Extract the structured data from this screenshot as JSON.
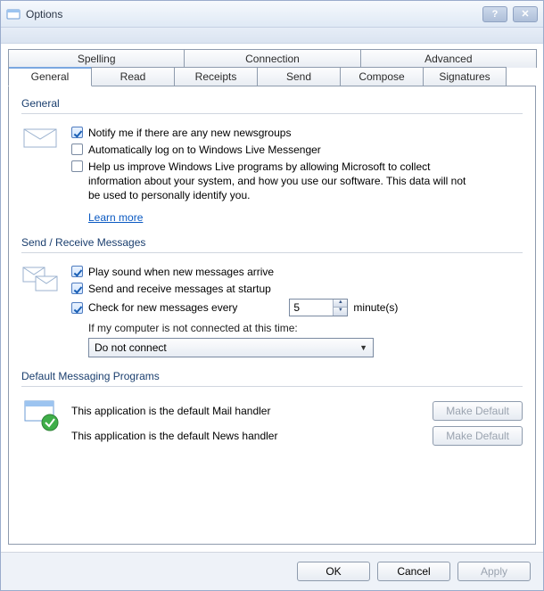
{
  "window": {
    "title": "Options"
  },
  "tabs_row1": {
    "spelling": "Spelling",
    "connection": "Connection",
    "advanced": "Advanced"
  },
  "tabs_row2": {
    "general": "General",
    "read": "Read",
    "receipts": "Receipts",
    "send": "Send",
    "compose": "Compose",
    "signatures": "Signatures"
  },
  "general": {
    "title": "General",
    "notify": "Notify me if there are any new newsgroups",
    "autologon": "Automatically log on to Windows Live Messenger",
    "help": "Help us improve Windows Live programs by allowing Microsoft to collect information about your system, and how you use our software. This data will not be used to personally identify you.",
    "learn_more": "Learn more"
  },
  "sendrecv": {
    "title": "Send / Receive Messages",
    "play_sound": "Play sound when new messages arrive",
    "startup": "Send and receive messages at startup",
    "check_every": "Check for new messages every",
    "minutes_value": "5",
    "minutes_label": "minute(s)",
    "offline_label": "If my computer is not connected at this time:",
    "offline_value": "Do not connect"
  },
  "defaults": {
    "title": "Default Messaging Programs",
    "mail": "This application is the default Mail handler",
    "news": "This application is the default News handler",
    "make_default": "Make Default"
  },
  "footer": {
    "ok": "OK",
    "cancel": "Cancel",
    "apply": "Apply"
  }
}
